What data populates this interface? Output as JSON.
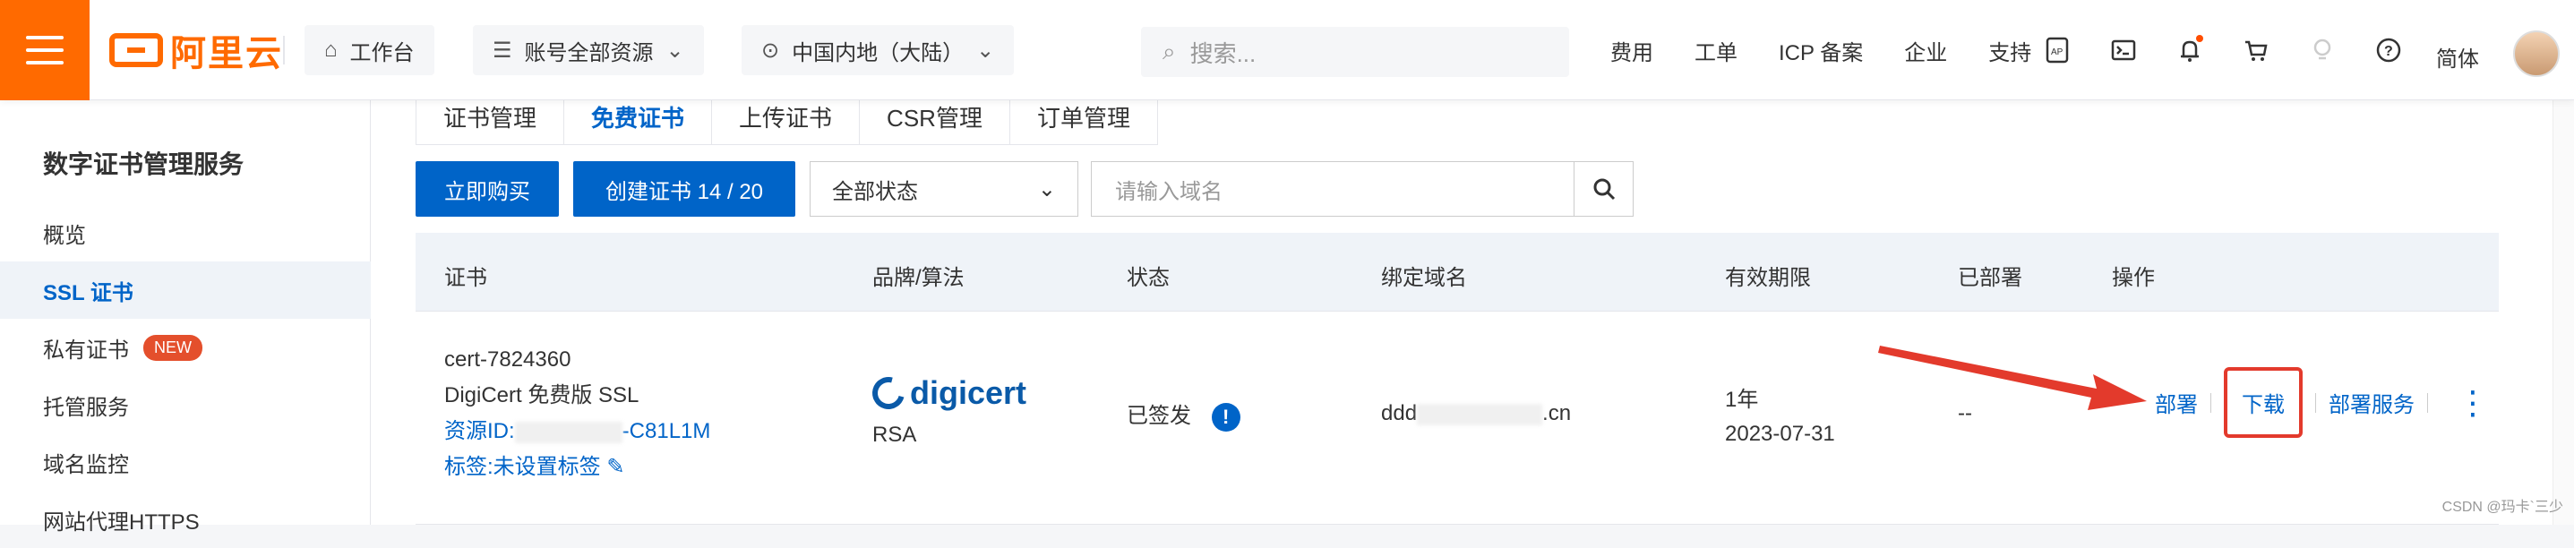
{
  "topbar": {
    "logo_text": "阿里云",
    "workbench": "工作台",
    "resources": "账号全部资源",
    "region": "中国内地（大陆）",
    "search_placeholder": "搜索...",
    "links": [
      "费用",
      "工单",
      "ICP 备案",
      "企业",
      "支持"
    ],
    "lang": "简体"
  },
  "sidebar": {
    "title": "数字证书管理服务",
    "items": [
      {
        "label": "概览"
      },
      {
        "label": "SSL 证书"
      },
      {
        "label": "私有证书",
        "badge": "NEW"
      },
      {
        "label": "托管服务"
      },
      {
        "label": "域名监控"
      },
      {
        "label": "网站代理HTTPS"
      }
    ]
  },
  "tabs": [
    "证书管理",
    "免费证书",
    "上传证书",
    "CSR管理",
    "订单管理"
  ],
  "toolbar": {
    "buy_label": "立即购买",
    "create_label": "创建证书 14 / 20",
    "status_select": "全部状态",
    "domain_placeholder": "请输入域名"
  },
  "table": {
    "headers": [
      "证书",
      "品牌/算法",
      "状态",
      "绑定域名",
      "有效期限",
      "已部署",
      "操作"
    ],
    "row": {
      "name": "cert-7824360",
      "product": "DigiCert 免费版 SSL",
      "resource_prefix": "资源ID:",
      "resource_suffix": "-C81L1M",
      "tag_label": "标签:未设置标签",
      "brand": "digicert",
      "algorithm": "RSA",
      "status": "已签发",
      "domain_prefix": "ddd",
      "domain_suffix": ".cn",
      "validity_period": "1年",
      "validity_date": "2023-07-31",
      "deployed": "--",
      "op_deploy": "部署",
      "op_download": "下载",
      "op_deploy_service": "部署服务"
    }
  },
  "watermark": "CSDN @玛卡`三少",
  "colors": {
    "accent": "#0064c8",
    "brand": "#ff6a00",
    "highlight": "#e33a2c"
  }
}
